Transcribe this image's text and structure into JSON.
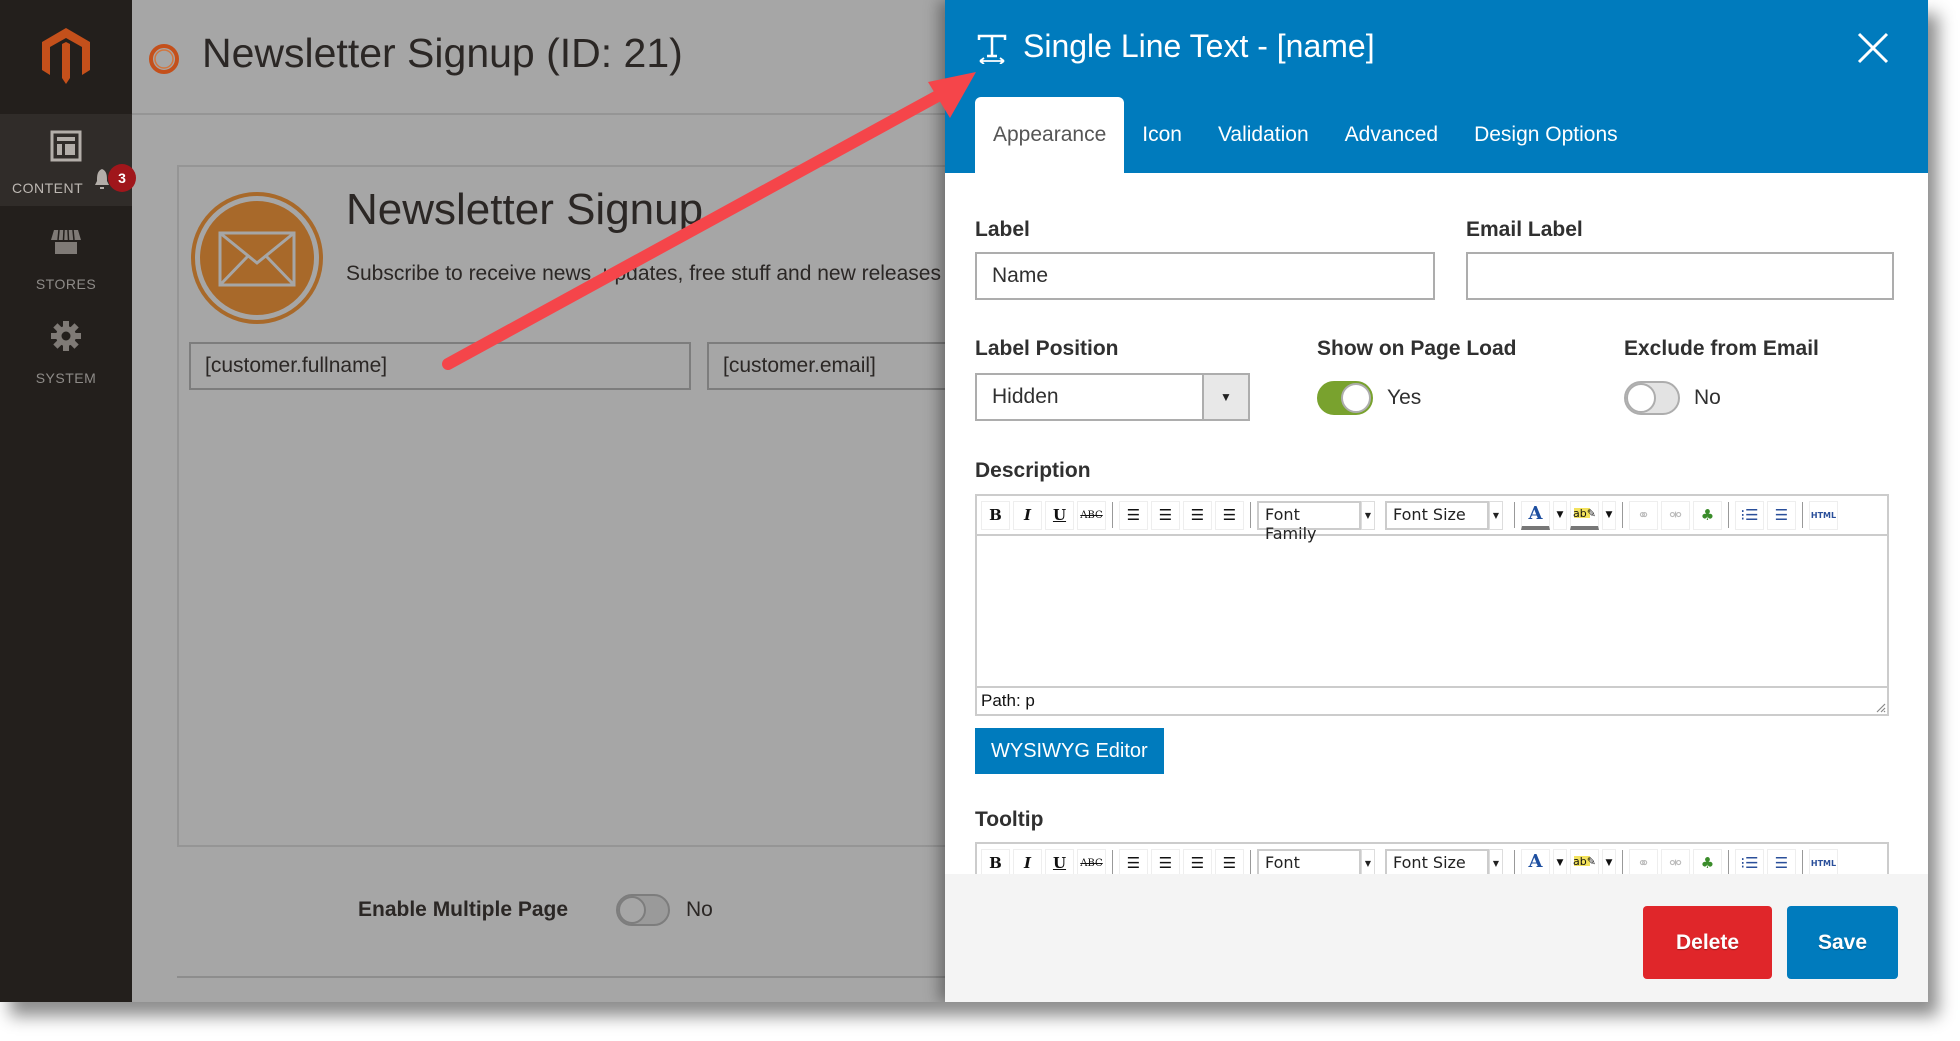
{
  "sidebar": {
    "logo": "magento-logo",
    "items": [
      {
        "label": "CONTENT",
        "icon": "layout-icon",
        "active": true,
        "notification_count": "3"
      },
      {
        "label": "STORES",
        "icon": "store-icon",
        "active": false
      },
      {
        "label": "SYSTEM",
        "icon": "gear-icon",
        "active": false
      }
    ]
  },
  "page": {
    "title": "Newsletter Signup (ID: 21)",
    "form_preview": {
      "title": "Newsletter Signup",
      "subtitle": "Subscribe to receive news, updates, free stuff and new releases",
      "fields": [
        "[customer.fullname]",
        "[customer.email]"
      ]
    },
    "enable_multiple_page": {
      "label": "Enable Multiple Page",
      "value": "No"
    }
  },
  "modal": {
    "title": "Single Line Text - [name]",
    "tabs": [
      "Appearance",
      "Icon",
      "Validation",
      "Advanced",
      "Design Options"
    ],
    "active_tab": "Appearance",
    "fields": {
      "label": {
        "label": "Label",
        "value": "Name"
      },
      "email_label": {
        "label": "Email Label",
        "value": ""
      },
      "label_position": {
        "label": "Label Position",
        "value": "Hidden"
      },
      "show_on_page_load": {
        "label": "Show on Page Load",
        "value": "Yes",
        "on": true
      },
      "exclude_from_email": {
        "label": "Exclude from Email",
        "value": "No",
        "on": false
      },
      "description": {
        "label": "Description",
        "path": "Path: p"
      },
      "tooltip": {
        "label": "Tooltip"
      }
    },
    "editor_toolbar": {
      "buttons": [
        "bold",
        "italic",
        "underline",
        "strikethrough",
        "align-left",
        "align-center",
        "align-right",
        "justify"
      ],
      "font_family": "Font Family",
      "font_size": "Font Size",
      "extra": [
        "text-color",
        "highlight-color",
        "link",
        "unlink",
        "image",
        "bullet-list",
        "numbered-list",
        "html"
      ],
      "html_label": "HTML"
    },
    "wysiwyg_button": "WYSIWYG Editor",
    "footer": {
      "delete": "Delete",
      "save": "Save"
    }
  },
  "colors": {
    "accent": "#007bbd",
    "delete": "#e0262a",
    "toggle_on": "#79a22e",
    "brand": "#eb5202",
    "annotation_arrow": "#f5454a"
  }
}
